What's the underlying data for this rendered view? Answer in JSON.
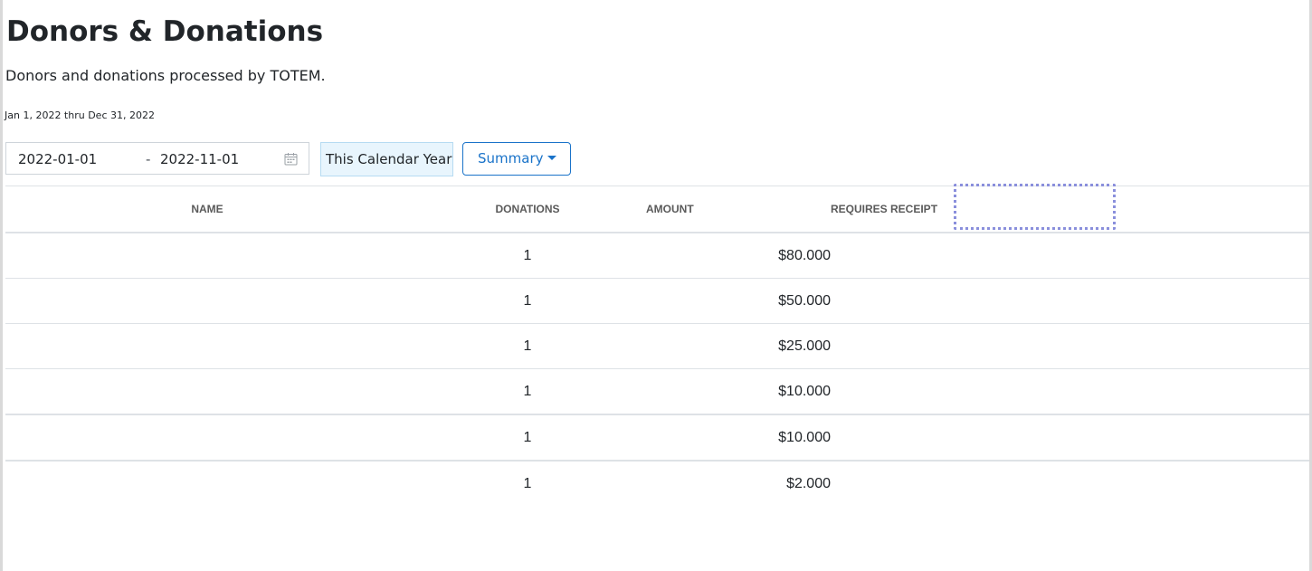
{
  "header": {
    "title": "Donors & Donations",
    "subtitle": "Donors and donations processed by TOTEM."
  },
  "filters": {
    "range_caption": "Jan 1, 2022 thru Dec 31, 2022",
    "start_date": "2022-01-01",
    "separator": "-",
    "end_date": "2022-11-01",
    "preset_label": "This Calendar Year",
    "view_label": "Summary",
    "icons": {
      "calendar": "calendar-icon",
      "caret": "caret-down-icon"
    }
  },
  "table": {
    "columns": [
      "NAME",
      "DONATIONS",
      "AMOUNT",
      "REQUIRES RECEIPT"
    ],
    "rows": [
      {
        "name": "",
        "donations": "1",
        "amount": "$80.000",
        "requires_receipt": ""
      },
      {
        "name": "",
        "donations": "1",
        "amount": "$50.000",
        "requires_receipt": ""
      },
      {
        "name": "",
        "donations": "1",
        "amount": "$25.000",
        "requires_receipt": ""
      },
      {
        "name": "",
        "donations": "1",
        "amount": "$10.000",
        "requires_receipt": ""
      },
      {
        "name": "",
        "donations": "1",
        "amount": "$10.000",
        "requires_receipt": ""
      },
      {
        "name": "",
        "donations": "1",
        "amount": "$2.000",
        "requires_receipt": ""
      }
    ]
  },
  "colors": {
    "accent": "#1a73c9",
    "preset_background": "#e8f5fd",
    "highlight": "#8a8fdc"
  }
}
